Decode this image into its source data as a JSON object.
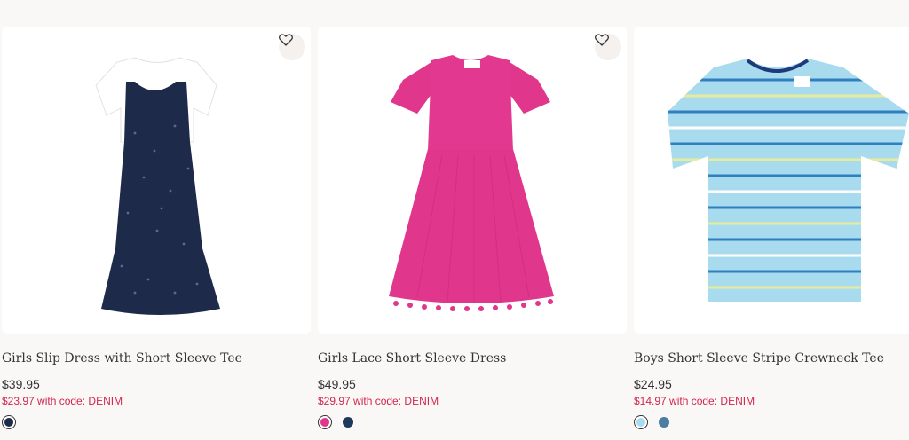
{
  "products": [
    {
      "title": "Girls Slip Dress with Short Sleeve Tee",
      "price": "$39.95",
      "promo": "$23.97 with code: DENIM",
      "swatches": [
        "#1e2a4a"
      ],
      "image_icon": "slip-dress-image"
    },
    {
      "title": "Girls Lace Short Sleeve Dress",
      "price": "$49.95",
      "promo": "$29.97 with code: DENIM",
      "swatches": [
        "#e0368c",
        "#1c3a5c"
      ],
      "image_icon": "pink-dress-image"
    },
    {
      "title": "Boys Short Sleeve Stripe Crewneck Tee",
      "price": "$24.95",
      "promo": "$14.97 with code: DENIM",
      "swatches": [
        "#a9dbef",
        "#4a7d9e"
      ],
      "image_icon": "striped-tee-image"
    }
  ],
  "colors": {
    "promo": "#d1264d",
    "background": "#faf8f6"
  }
}
